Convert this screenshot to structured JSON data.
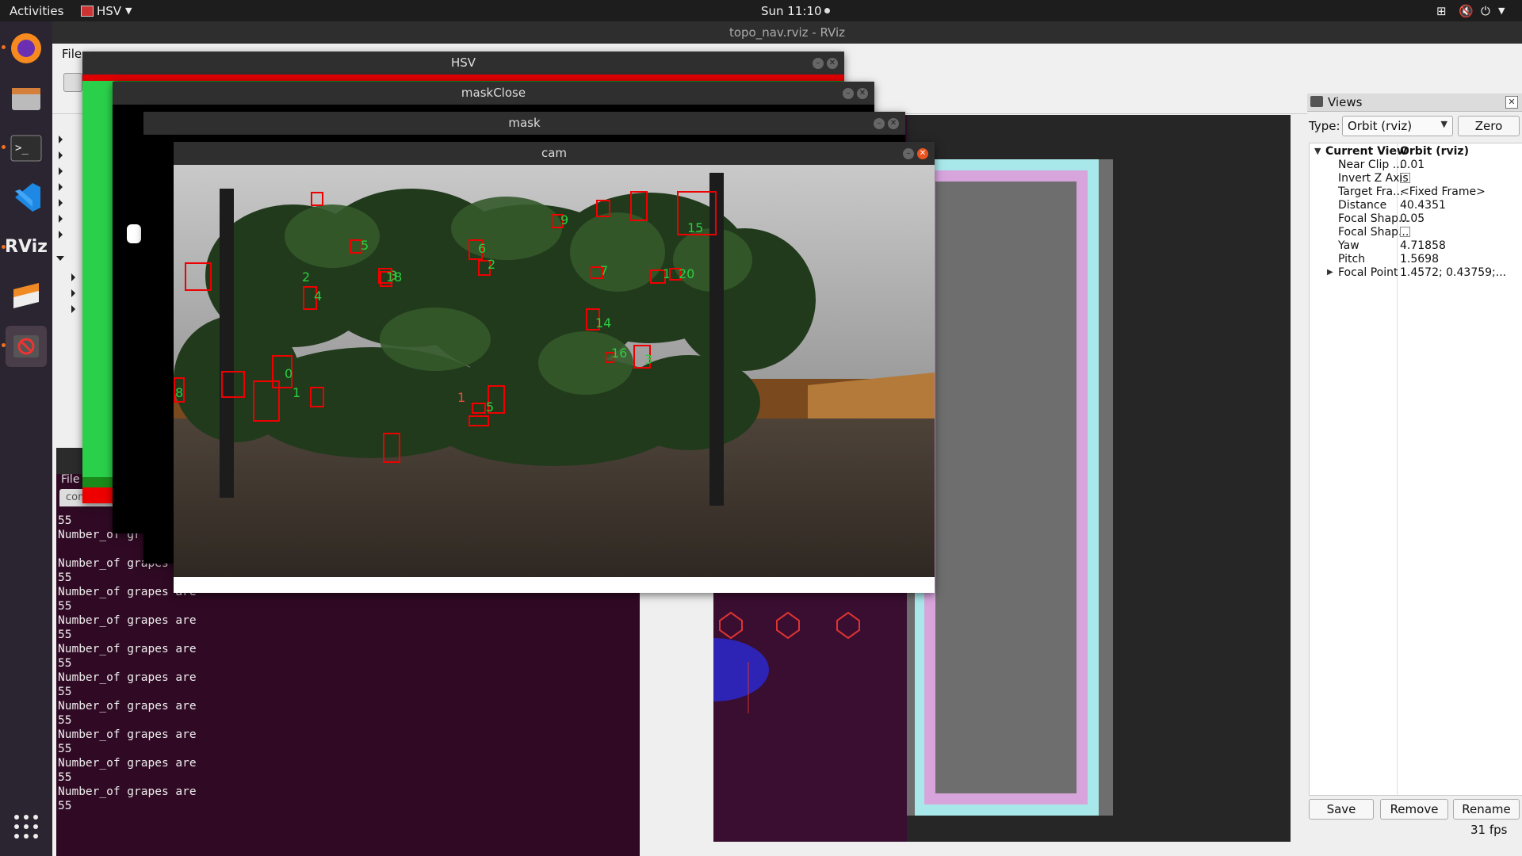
{
  "topbar": {
    "activities": "Activities",
    "app_name": "HSV",
    "clock": "Sun 11:10"
  },
  "dock": {
    "items": [
      "firefox-icon",
      "files-icon",
      "terminal-icon",
      "vscode-icon",
      "rviz-icon",
      "sublime-icon",
      "stop-icon",
      "app-grid-icon"
    ],
    "rviz_label": "RViz"
  },
  "rviz": {
    "window_title": "topo_nav.rviz - RViz",
    "menu": {
      "file": "File"
    },
    "fps": "31 fps"
  },
  "views": {
    "panel_title": "Views",
    "type_label": "Type:",
    "type_value": "Orbit (rviz)",
    "zero_button": "Zero",
    "properties": [
      {
        "name": "Current View",
        "value": "Orbit (rviz)"
      },
      {
        "name": "Near Clip ...",
        "value": "0.01"
      },
      {
        "name": "Invert Z Axis",
        "value": ""
      },
      {
        "name": "Target Fra...",
        "value": "<Fixed Frame>"
      },
      {
        "name": "Distance",
        "value": "40.4351"
      },
      {
        "name": "Focal Shap...",
        "value": "0.05"
      },
      {
        "name": "Focal Shap...",
        "value": ""
      },
      {
        "name": "Yaw",
        "value": "4.71858"
      },
      {
        "name": "Pitch",
        "value": "1.5698"
      },
      {
        "name": "Focal Point",
        "value": "1.4572; 0.43759;..."
      }
    ],
    "save_button": "Save",
    "remove_button": "Remove",
    "rename_button": "Rename"
  },
  "terminal": {
    "menu_file": "File",
    "tab_label": "comp...",
    "lines": [
      "55",
      "Number_of gr",
      "Number_of grapes",
      "55",
      "Number_of grapes are",
      "55",
      "Number_of grapes are",
      "55",
      "Number_of grapes are",
      "55",
      "Number_of grapes are",
      "55",
      "Number_of grapes are",
      "55",
      "Number_of grapes are",
      "55",
      "Number_of grapes are",
      "55",
      "Number_of grapes are",
      "55",
      "Number_of grapes are",
      "55"
    ]
  },
  "windows": {
    "hsv": {
      "title": "HSV"
    },
    "maskclose": {
      "title": "maskClose"
    },
    "mask": {
      "title": "mask"
    },
    "cam": {
      "title": "cam"
    }
  },
  "detections": [
    {
      "label": "5"
    },
    {
      "label": "3"
    },
    {
      "label": "18"
    },
    {
      "label": "2"
    },
    {
      "label": "4"
    },
    {
      "label": "6"
    },
    {
      "label": "9"
    },
    {
      "label": "7"
    },
    {
      "label": "15"
    },
    {
      "label": "1"
    },
    {
      "label": "20"
    },
    {
      "label": "14"
    },
    {
      "label": "16"
    },
    {
      "label": "3"
    },
    {
      "label": "0"
    },
    {
      "label": "8"
    },
    {
      "label": "1"
    },
    {
      "label": "5"
    },
    {
      "label": "2"
    },
    {
      "label": "1"
    }
  ],
  "colors": {
    "bbox": "#ff0000",
    "label": "#2ecc40",
    "terminal_bg": "#300a24",
    "render_bg": "#262626"
  }
}
